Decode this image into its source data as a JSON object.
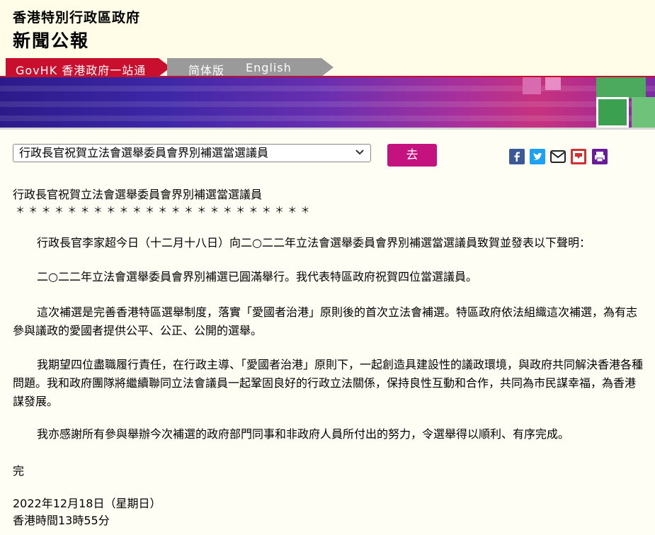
{
  "header": {
    "line1": "香港特別行政區政府",
    "line2": "新聞公報"
  },
  "nav": {
    "govhk": "GovHK 香港政府一站通",
    "simplified": "简体版",
    "english": "English"
  },
  "toolbar": {
    "select_value": "行政長官祝賀立法會選舉委員會界別補選當選議員",
    "go_label": "去"
  },
  "share_icons": [
    "facebook-icon",
    "twitter-icon",
    "email-icon",
    "bookmark-icon",
    "print-icon"
  ],
  "article": {
    "title": "行政長官祝賀立法會選舉委員會界別補選當選議員",
    "stars": "＊＊＊＊＊＊＊＊＊＊＊＊＊＊＊＊＊＊＊＊＊＊＊",
    "paragraphs": [
      "行政長官李家超今日（十二月十八日）向二○二二年立法會選舉委員會界別補選當選議員致賀並發表以下聲明：",
      "二○二二年立法會選舉委員會界別補選已圓滿舉行。我代表特區政府祝賀四位當選議員。",
      "這次補選是完善香港特區選舉制度，落實「愛國者治港」原則後的首次立法會補選。特區政府依法組織這次補選，為有志參與議政的愛國者提供公平、公正、公開的選舉。",
      "我期望四位盡職履行責任，在行政主導、「愛國者治港」原則下，一起創造具建設性的議政環境，與政府共同解決香港各種問題。我和政府團隊將繼續聯同立法會議員一起鞏固良好的行政立法關係，保持良性互動和合作，共同為市民謀幸福，為香港謀發展。",
      "我亦感謝所有參與舉辦今次補選的政府部門同事和非政府人員所付出的努力，令選舉得以順利、有序完成。"
    ],
    "end": "完",
    "date": "2022年12月18日（星期日）",
    "time": "香港時間13時55分"
  },
  "colors": {
    "nav_red": "#c8102e",
    "go_button": "#c4137e",
    "facebook": "#3b5998",
    "twitter": "#1da1f2",
    "bookmark": "#d32f2f",
    "print": "#6a1b9a"
  }
}
